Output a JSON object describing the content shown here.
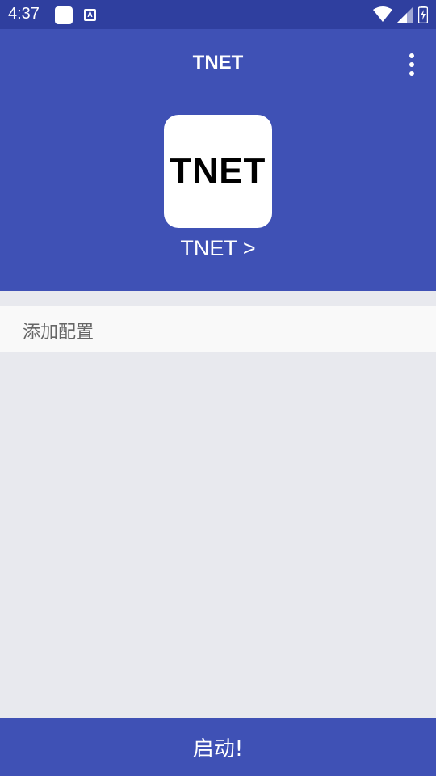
{
  "status_bar": {
    "time": "4:37",
    "notification_b_glyph": "A",
    "icons": [
      "app-notification-icon",
      "a-notification-icon",
      "wifi-icon",
      "cell-signal-icon",
      "battery-charging-icon"
    ]
  },
  "header": {
    "title": "TNET",
    "logo_text": "TNET",
    "profile_link": "TNET >",
    "menu_icon": "overflow-menu-icon"
  },
  "list": {
    "add_config_label": "添加配置"
  },
  "footer": {
    "start_label": "启动!"
  },
  "colors": {
    "status_bar": "#2f3f9f",
    "primary": "#3f51b5",
    "background": "#e8e9ee",
    "row_background": "#f9f9f9"
  }
}
